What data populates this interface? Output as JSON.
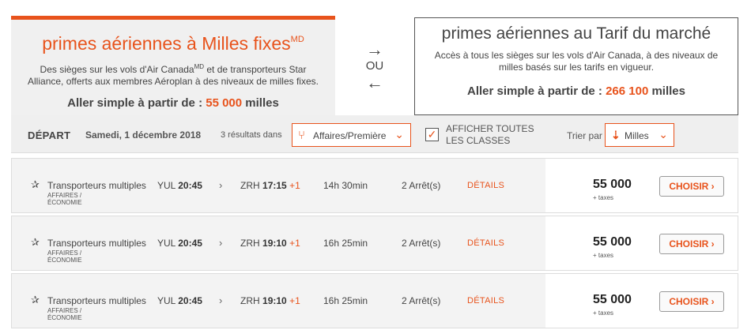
{
  "fixed_card": {
    "title": "primes aériennes à Milles fixes",
    "title_sup": "MD",
    "desc_part1": "Des sièges sur les vols d'Air Canada",
    "desc_sup": "MD",
    "desc_part2": " et de transporteurs Star Alliance, offerts aux membres Aéroplan à des niveaux de milles fixes.",
    "price_prefix": "Aller simple à partir de :",
    "price_value": "55 000",
    "price_suffix": "milles"
  },
  "swap": {
    "arrow_right": "→",
    "ou": "OU",
    "arrow_left": "←"
  },
  "market_card": {
    "title": "primes aériennes au Tarif du marché",
    "desc": "Accès à tous les sièges sur les vols d'Air Canada, à des niveaux de milles basés sur les tarifs en vigueur.",
    "price_prefix": "Aller simple à partir de :",
    "price_value": "266 100",
    "price_suffix": "milles"
  },
  "filter": {
    "depart_label": "DÉPART",
    "date": "Samedi, 1 décembre 2018",
    "results": "3 résultats dans",
    "cabin_value": "Affaires/Première",
    "show_all_label": "AFFICHER TOUTES LES CLASSES",
    "show_all_checked": true,
    "sort_label": "Trier par",
    "sort_value": "Milles"
  },
  "flights": [
    {
      "carrier": "Transporteurs multiples",
      "cabin": "AFFAIRES / ÉCONOMIE",
      "dep_code": "YUL",
      "dep_time": "20:45",
      "arr_code": "ZRH",
      "arr_time": "17:15",
      "arr_plus": "+1",
      "duration": "14h 30min",
      "stops": "2 Arrêt(s)",
      "details": "DÉTAILS",
      "price": "55 000",
      "taxes": "+ taxes",
      "choose": "CHOISIR ›"
    },
    {
      "carrier": "Transporteurs multiples",
      "cabin": "AFFAIRES / ÉCONOMIE",
      "dep_code": "YUL",
      "dep_time": "20:45",
      "arr_code": "ZRH",
      "arr_time": "19:10",
      "arr_plus": "+1",
      "duration": "16h 25min",
      "stops": "2 Arrêt(s)",
      "details": "DÉTAILS",
      "price": "55 000",
      "taxes": "+ taxes",
      "choose": "CHOISIR ›"
    },
    {
      "carrier": "Transporteurs multiples",
      "cabin": "AFFAIRES / ÉCONOMIE",
      "dep_code": "YUL",
      "dep_time": "20:45",
      "arr_code": "ZRH",
      "arr_time": "19:10",
      "arr_plus": "+1",
      "duration": "16h 25min",
      "stops": "2 Arrêt(s)",
      "details": "DÉTAILS",
      "price": "55 000",
      "taxes": "+ taxes",
      "choose": "CHOISIR ›"
    }
  ],
  "colors": {
    "accent": "#e8531c",
    "panel": "#f0f0f0"
  },
  "icons": {
    "star": "star-alliance-icon",
    "seat": "seat-icon",
    "sort": "sort-icon",
    "chevron": "chevron-down-icon"
  }
}
